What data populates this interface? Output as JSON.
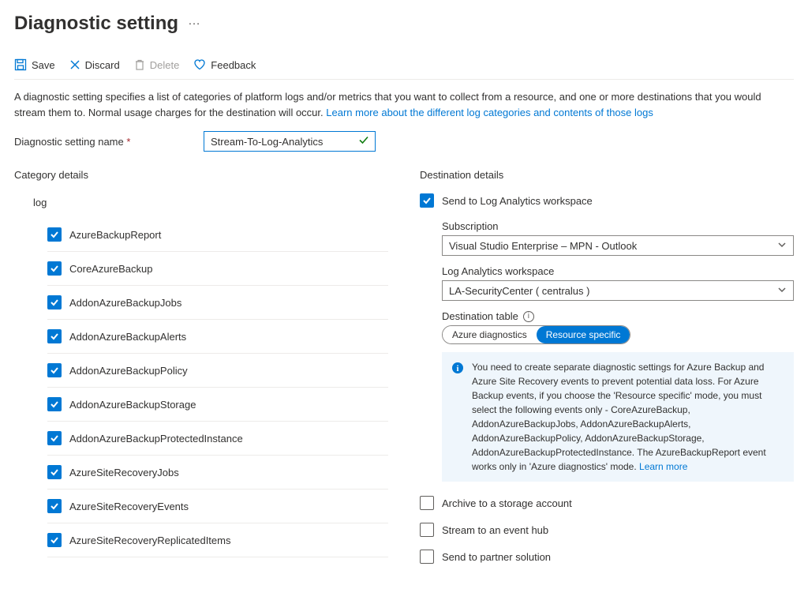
{
  "page_title": "Diagnostic setting",
  "toolbar": {
    "save": "Save",
    "discard": "Discard",
    "delete": "Delete",
    "feedback": "Feedback"
  },
  "description": {
    "text": "A diagnostic setting specifies a list of categories of platform logs and/or metrics that you want to collect from a resource, and one or more destinations that you would stream them to. Normal usage charges for the destination will occur. ",
    "link": "Learn more about the different log categories and contents of those logs"
  },
  "name_field": {
    "label": "Diagnostic setting name",
    "value": "Stream-To-Log-Analytics"
  },
  "category": {
    "heading": "Category details",
    "log_header": "log",
    "items": [
      "AzureBackupReport",
      "CoreAzureBackup",
      "AddonAzureBackupJobs",
      "AddonAzureBackupAlerts",
      "AddonAzureBackupPolicy",
      "AddonAzureBackupStorage",
      "AddonAzureBackupProtectedInstance",
      "AzureSiteRecoveryJobs",
      "AzureSiteRecoveryEvents",
      "AzureSiteRecoveryReplicatedItems"
    ]
  },
  "destination": {
    "heading": "Destination details",
    "log_analytics": {
      "label": "Send to Log Analytics workspace",
      "subscription_label": "Subscription",
      "subscription_value": "Visual Studio Enterprise – MPN - Outlook",
      "workspace_label": "Log Analytics workspace",
      "workspace_value": "LA-SecurityCenter ( centralus )",
      "dest_table_label": "Destination table",
      "toggle_azure": "Azure diagnostics",
      "toggle_resource": "Resource specific",
      "info_text": "You need to create separate diagnostic settings for Azure Backup and Azure Site Recovery events to prevent potential data loss. For Azure Backup events, if you choose the 'Resource specific' mode, you must select the following events only - CoreAzureBackup, AddonAzureBackupJobs, AddonAzureBackupAlerts, AddonAzureBackupPolicy, AddonAzureBackupStorage, AddonAzureBackupProtectedInstance. The AzureBackupReport event works only in 'Azure diagnostics' mode. ",
      "info_link": "Learn more"
    },
    "archive": "Archive to a storage account",
    "eventhub": "Stream to an event hub",
    "partner": "Send to partner solution"
  }
}
